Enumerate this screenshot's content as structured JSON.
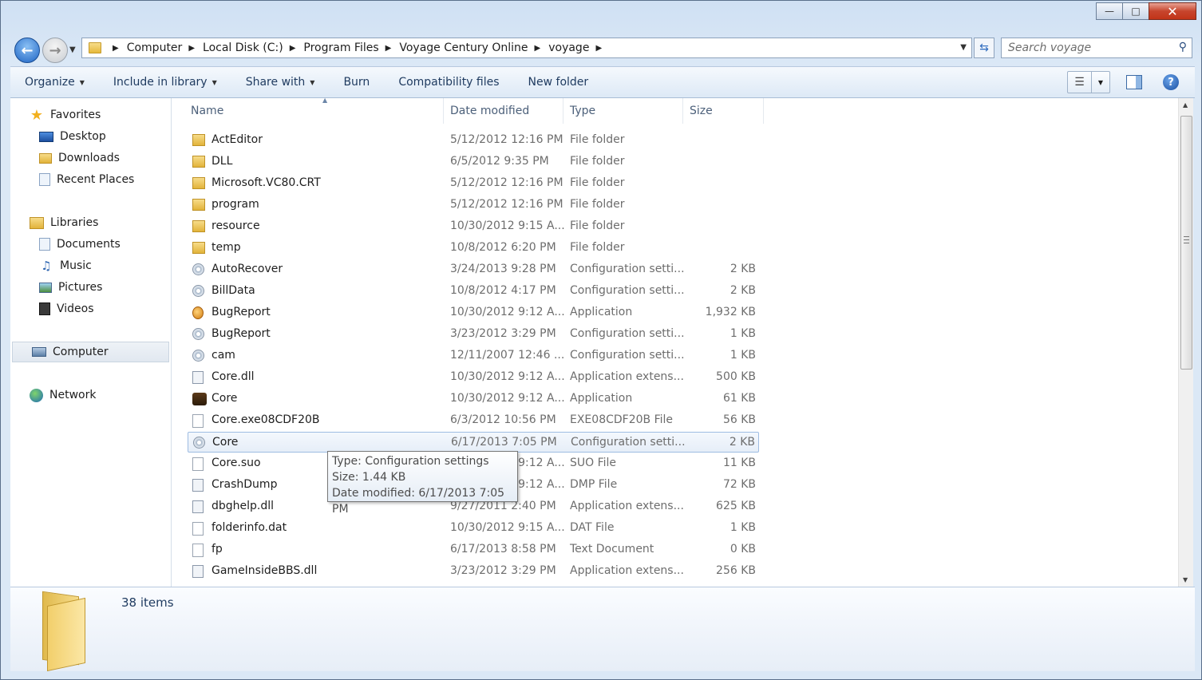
{
  "window": {
    "minimize": "—",
    "maximize": "□",
    "close": "✕"
  },
  "nav": {
    "back_symbol": "←",
    "forward_symbol": "→"
  },
  "address": {
    "crumbs": [
      "Computer",
      "Local Disk (C:)",
      "Program Files",
      "Voyage Century Online",
      "voyage"
    ]
  },
  "search": {
    "placeholder": "Search voyage"
  },
  "toolbar": {
    "organize": "Organize",
    "include_in_library": "Include in library",
    "share_with": "Share with",
    "burn": "Burn",
    "compatibility_files": "Compatibility files",
    "new_folder": "New folder"
  },
  "sidebar": {
    "favorites": {
      "label": "Favorites",
      "items": [
        "Desktop",
        "Downloads",
        "Recent Places"
      ]
    },
    "libraries": {
      "label": "Libraries",
      "items": [
        "Documents",
        "Music",
        "Pictures",
        "Videos"
      ]
    },
    "computer": "Computer",
    "network": "Network"
  },
  "columns": {
    "name": "Name",
    "date": "Date modified",
    "type": "Type",
    "size": "Size"
  },
  "files": [
    {
      "name": "ActEditor",
      "date": "5/12/2012 12:16 PM",
      "type": "File folder",
      "size": "",
      "icon": "folder-icon"
    },
    {
      "name": "DLL",
      "date": "6/5/2012 9:35 PM",
      "type": "File folder",
      "size": "",
      "icon": "folder-icon"
    },
    {
      "name": "Microsoft.VC80.CRT",
      "date": "5/12/2012 12:16 PM",
      "type": "File folder",
      "size": "",
      "icon": "folder-icon"
    },
    {
      "name": "program",
      "date": "5/12/2012 12:16 PM",
      "type": "File folder",
      "size": "",
      "icon": "folder-icon"
    },
    {
      "name": "resource",
      "date": "10/30/2012 9:15 A...",
      "type": "File folder",
      "size": "",
      "icon": "folder-icon"
    },
    {
      "name": "temp",
      "date": "10/8/2012 6:20 PM",
      "type": "File folder",
      "size": "",
      "icon": "folder-icon"
    },
    {
      "name": "AutoRecover",
      "date": "3/24/2013 9:28 PM",
      "type": "Configuration setti...",
      "size": "2 KB",
      "icon": "config-icon"
    },
    {
      "name": "BillData",
      "date": "10/8/2012 4:17 PM",
      "type": "Configuration setti...",
      "size": "2 KB",
      "icon": "config-icon"
    },
    {
      "name": "BugReport",
      "date": "10/30/2012 9:12 A...",
      "type": "Application",
      "size": "1,932 KB",
      "icon": "app-icon"
    },
    {
      "name": "BugReport",
      "date": "3/23/2012 3:29 PM",
      "type": "Configuration setti...",
      "size": "1 KB",
      "icon": "config-icon"
    },
    {
      "name": "cam",
      "date": "12/11/2007 12:46 ...",
      "type": "Configuration setti...",
      "size": "1 KB",
      "icon": "config-icon"
    },
    {
      "name": "Core.dll",
      "date": "10/30/2012 9:12 A...",
      "type": "Application extens...",
      "size": "500 KB",
      "icon": "dll-icon"
    },
    {
      "name": "Core",
      "date": "10/30/2012 9:12 A...",
      "type": "Application",
      "size": "61 KB",
      "icon": "ship-icon"
    },
    {
      "name": "Core.exe08CDF20B",
      "date": "6/3/2012 10:56 PM",
      "type": "EXE08CDF20B File",
      "size": "56 KB",
      "icon": "blank-file-icon"
    },
    {
      "name": "Core",
      "date": "6/17/2013 7:05 PM",
      "type": "Configuration setti...",
      "size": "2 KB",
      "icon": "config-icon",
      "selected": true
    },
    {
      "name": "Core.suo",
      "date": "10/30/2012 9:12 A...",
      "type": "SUO File",
      "size": "11 KB",
      "icon": "blank-file-icon"
    },
    {
      "name": "CrashDump",
      "date": "10/30/2012 9:12 A...",
      "type": "DMP File",
      "size": "72 KB",
      "icon": "dmp-icon"
    },
    {
      "name": "dbghelp.dll",
      "date": "9/27/2011 2:40 PM",
      "type": "Application extens...",
      "size": "625 KB",
      "icon": "dll-icon"
    },
    {
      "name": "folderinfo.dat",
      "date": "10/30/2012 9:15 A...",
      "type": "DAT File",
      "size": "1 KB",
      "icon": "blank-file-icon"
    },
    {
      "name": "fp",
      "date": "6/17/2013 8:58 PM",
      "type": "Text Document",
      "size": "0 KB",
      "icon": "text-file-icon"
    },
    {
      "name": "GameInsideBBS.dll",
      "date": "3/23/2012 3:29 PM",
      "type": "Application extens...",
      "size": "256 KB",
      "icon": "dll-icon"
    }
  ],
  "tooltip": {
    "type": "Type: Configuration settings",
    "size": "Size: 1.44 KB",
    "date": "Date modified: 6/17/2013 7:05 PM"
  },
  "status": {
    "count": "38 items"
  }
}
